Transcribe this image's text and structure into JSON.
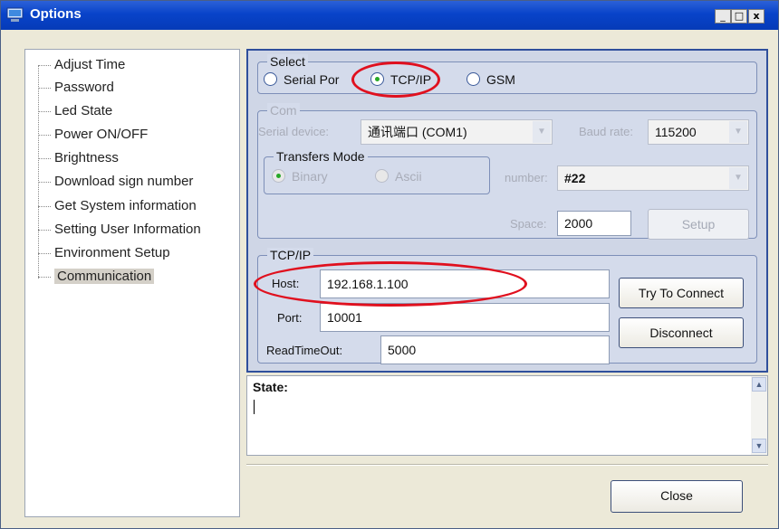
{
  "window": {
    "title": "Options",
    "min_symbol": "_",
    "max_symbol": "□",
    "close_symbol": "x"
  },
  "tree": {
    "items": [
      {
        "label": "Adjust Time"
      },
      {
        "label": "Password"
      },
      {
        "label": "Led State"
      },
      {
        "label": "Power ON/OFF"
      },
      {
        "label": "Brightness"
      },
      {
        "label": "Download sign number"
      },
      {
        "label": "Get System information"
      },
      {
        "label": "Setting User Information"
      },
      {
        "label": "Environment Setup"
      },
      {
        "label": "Communication",
        "selected": true
      }
    ]
  },
  "select_group": {
    "label": "Select",
    "options": [
      {
        "label": "Serial Por",
        "checked": false
      },
      {
        "label": "TCP/IP",
        "checked": true
      },
      {
        "label": "GSM",
        "checked": false
      }
    ]
  },
  "com_group": {
    "label": "Com",
    "serial_device_label": "Serial device:",
    "serial_device_value": "通讯端口 (COM1)",
    "baud_rate_label": "Baud rate:",
    "baud_rate_value": "115200",
    "transfers_mode": {
      "label": "Transfers Mode",
      "options": [
        {
          "label": "Binary",
          "checked": true
        },
        {
          "label": "Ascii",
          "checked": false
        }
      ]
    },
    "number_label": "number:",
    "number_value": "#22",
    "space_label": "Space:",
    "space_value": "2000",
    "setup_button": "Setup"
  },
  "tcpip_group": {
    "label": "TCP/IP",
    "host_label": "Host:",
    "host_value": "192.168.1.100",
    "port_label": "Port:",
    "port_value": "10001",
    "readtimeout_label": "ReadTimeOut:",
    "readtimeout_value": "5000",
    "try_connect_button": "Try To Connect",
    "disconnect_button": "Disconnect"
  },
  "state": {
    "label": "State:",
    "value": ""
  },
  "close_button": "Close",
  "colors": {
    "title_bar": "#0843c9",
    "highlight_ellipse": "#e0101e",
    "panel_border": "#2f4f9c"
  }
}
